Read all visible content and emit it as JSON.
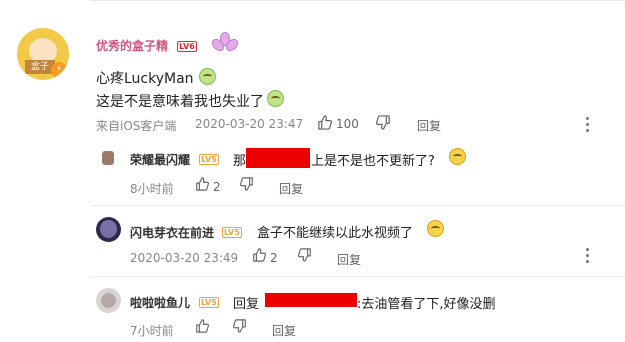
{
  "comments": [
    {
      "user": "优秀的盒子精",
      "level": "LV6",
      "line1": "心疼LuckyMan",
      "line2": "这是不是意味着我也失业了",
      "source": "来自iOS客户端",
      "date": "2020-03-20 23:47",
      "likes": "100",
      "reply": "回复",
      "avatar_badge": "盒子"
    },
    {
      "user": "荣耀最闪耀",
      "level": "LV5",
      "text_pre": "那",
      "text_post": "上是不是也不更新了?",
      "time": "8小时前",
      "likes": "2",
      "reply": "回复"
    },
    {
      "user": "闪电芽衣在前进",
      "level": "LV5",
      "text": "盒子不能继续以此水视频了",
      "date": "2020-03-20 23:49",
      "likes": "2",
      "reply": "回复"
    },
    {
      "user": "啦啦啦鱼儿",
      "level": "LV5",
      "text_pre": "回复",
      "text_post": ":去油管看了下,好像没删",
      "time": "7小时前",
      "reply": "回复"
    }
  ],
  "colors": {
    "username_pink": "#d1577f",
    "level_red": "#e5232a",
    "level_orange": "#f1a33a",
    "redaction": "#ee0000"
  },
  "icons": [
    "thumb-up-icon",
    "thumb-down-icon",
    "more-vertical-icon",
    "emoji-icon",
    "flower-badge-icon",
    "bolt-icon"
  ]
}
